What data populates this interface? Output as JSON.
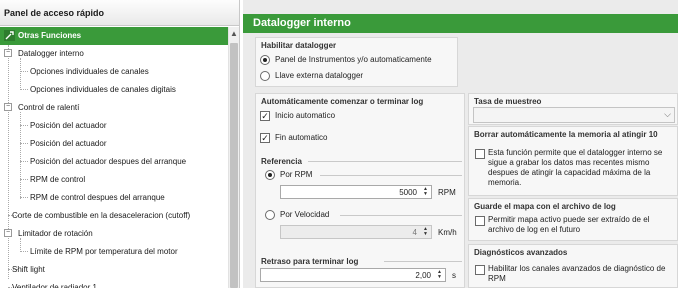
{
  "left_panel": {
    "title": "Panel de acceso rápido",
    "category": "Otras Funciones",
    "tree": [
      {
        "label": "Datalogger interno",
        "expander": "−",
        "selected": true
      },
      {
        "label": "Opciones individuales de canales"
      },
      {
        "label": "Opciones individuales de canales digitais"
      },
      {
        "label": "Control de ralentí",
        "expander": "−"
      },
      {
        "label": "Posición del actuador"
      },
      {
        "label": "Posición del actuador"
      },
      {
        "label": "Posición del actuador despues del arranque"
      },
      {
        "label": "RPM de control"
      },
      {
        "label": "RPM de control despues del arranque"
      },
      {
        "label": "Corte de combustible en la desaceleracion (cutoff)"
      },
      {
        "label": "Limitador de rotación",
        "expander": "−"
      },
      {
        "label": "Límite de RPM por temperatura del motor"
      },
      {
        "label": "Shift light"
      },
      {
        "label": "Ventilador de radiador 1"
      }
    ]
  },
  "main": {
    "title": "Datalogger interno",
    "enable": {
      "title": "Habilitar datalogger",
      "option_panel": "Panel de Instrumentos y/o automaticamente",
      "option_key": "Llave externa datalogger",
      "selected": "panel"
    },
    "auto_log": {
      "title": "Automáticamente comenzar o terminar log",
      "auto_start": "Inicio automatico",
      "auto_end": "Fin automatico",
      "reference_title": "Referencia",
      "by_rpm": "Por RPM",
      "rpm_value": "5000",
      "rpm_unit": "RPM",
      "by_speed": "Por Velocidad",
      "speed_value": "4",
      "speed_unit": "Km/h",
      "delay_title": "Retraso para terminar log",
      "delay_value": "2,00",
      "delay_unit": "s"
    },
    "sample_rate": {
      "title": "Tasa de muestreo",
      "value": ""
    },
    "auto_erase": {
      "title": "Borrar automáticamente la memoria al atingir 10",
      "description": "Esta función permite que el datalogger interno se sigue a grabar los datos mas recentes mismo despues de atingir la capacidad máxima de la memoria."
    },
    "save_map": {
      "title": "Guarde el mapa con el archivo de log",
      "description": "Permitir mapa activo puede ser extraído de el archivo de log en el futuro"
    },
    "advanced": {
      "title": "Diagnósticos avanzados",
      "description": "Habilitar los canales avanzados de diagnóstico de RPM"
    }
  }
}
